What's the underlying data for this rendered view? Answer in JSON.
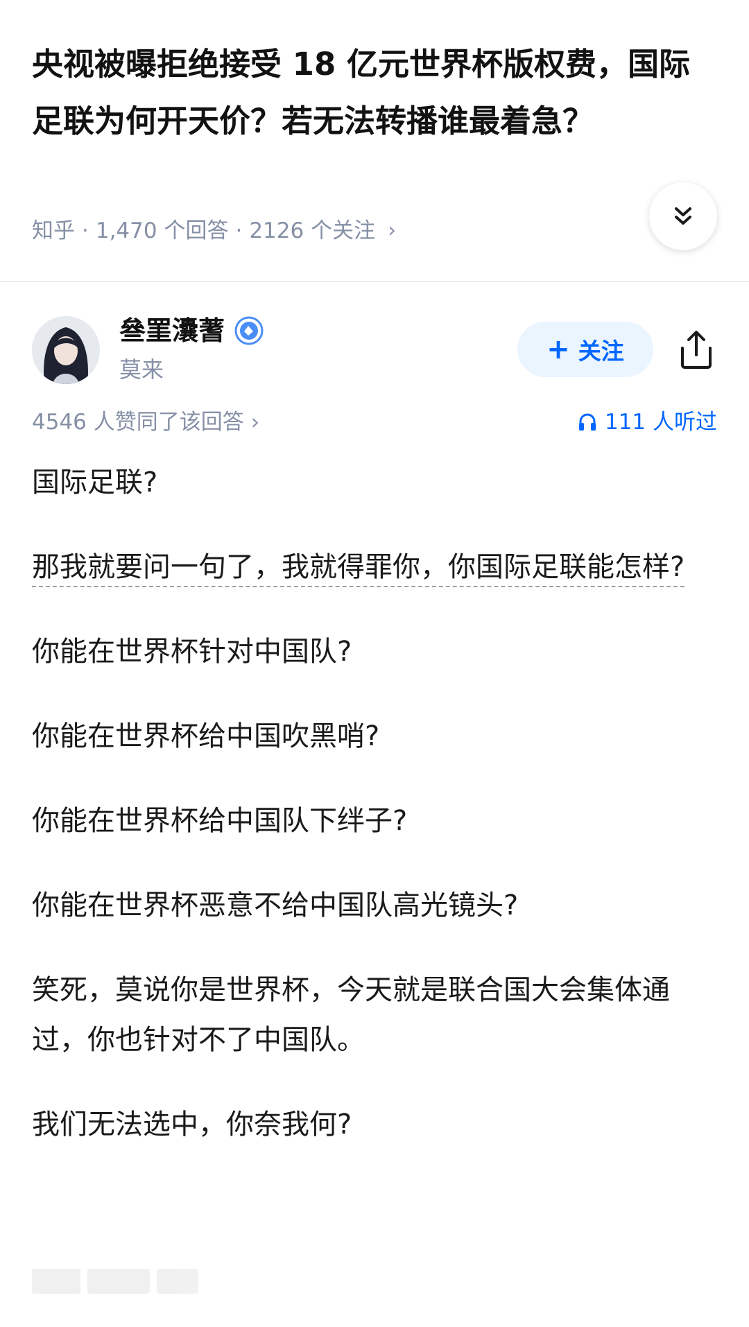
{
  "question": {
    "title": "央视被曝拒绝接受 18 亿元世界杯版权费，国际足联为何开天价？若无法转播谁最着急？",
    "source": "知乎",
    "answers_count": "1,470 个回答",
    "followers_count": "2126 个关注"
  },
  "author": {
    "name": "叄罣灢蓍",
    "subtitle": "莫来",
    "follow_label": "关注",
    "badge_icon": "verified-badge-icon",
    "accent_color": "#0066ff"
  },
  "answer": {
    "votes_text": "4546 人赞同了该回答",
    "listen_text": "111 人听过",
    "paragraphs": [
      "国际足联?",
      "那我就要问一句了，我就得罪你，你国际足联能怎样?",
      "你能在世界杯针对中国队?",
      "你能在世界杯给中国吹黑哨?",
      "你能在世界杯给中国队下绊子?",
      "你能在世界杯恶意不给中国队高光镜头?",
      "笑死，莫说你是世界杯，今天就是联合国大会集体通过，你也针对不了中国队。",
      "我们无法选中，你奈我何?"
    ]
  }
}
